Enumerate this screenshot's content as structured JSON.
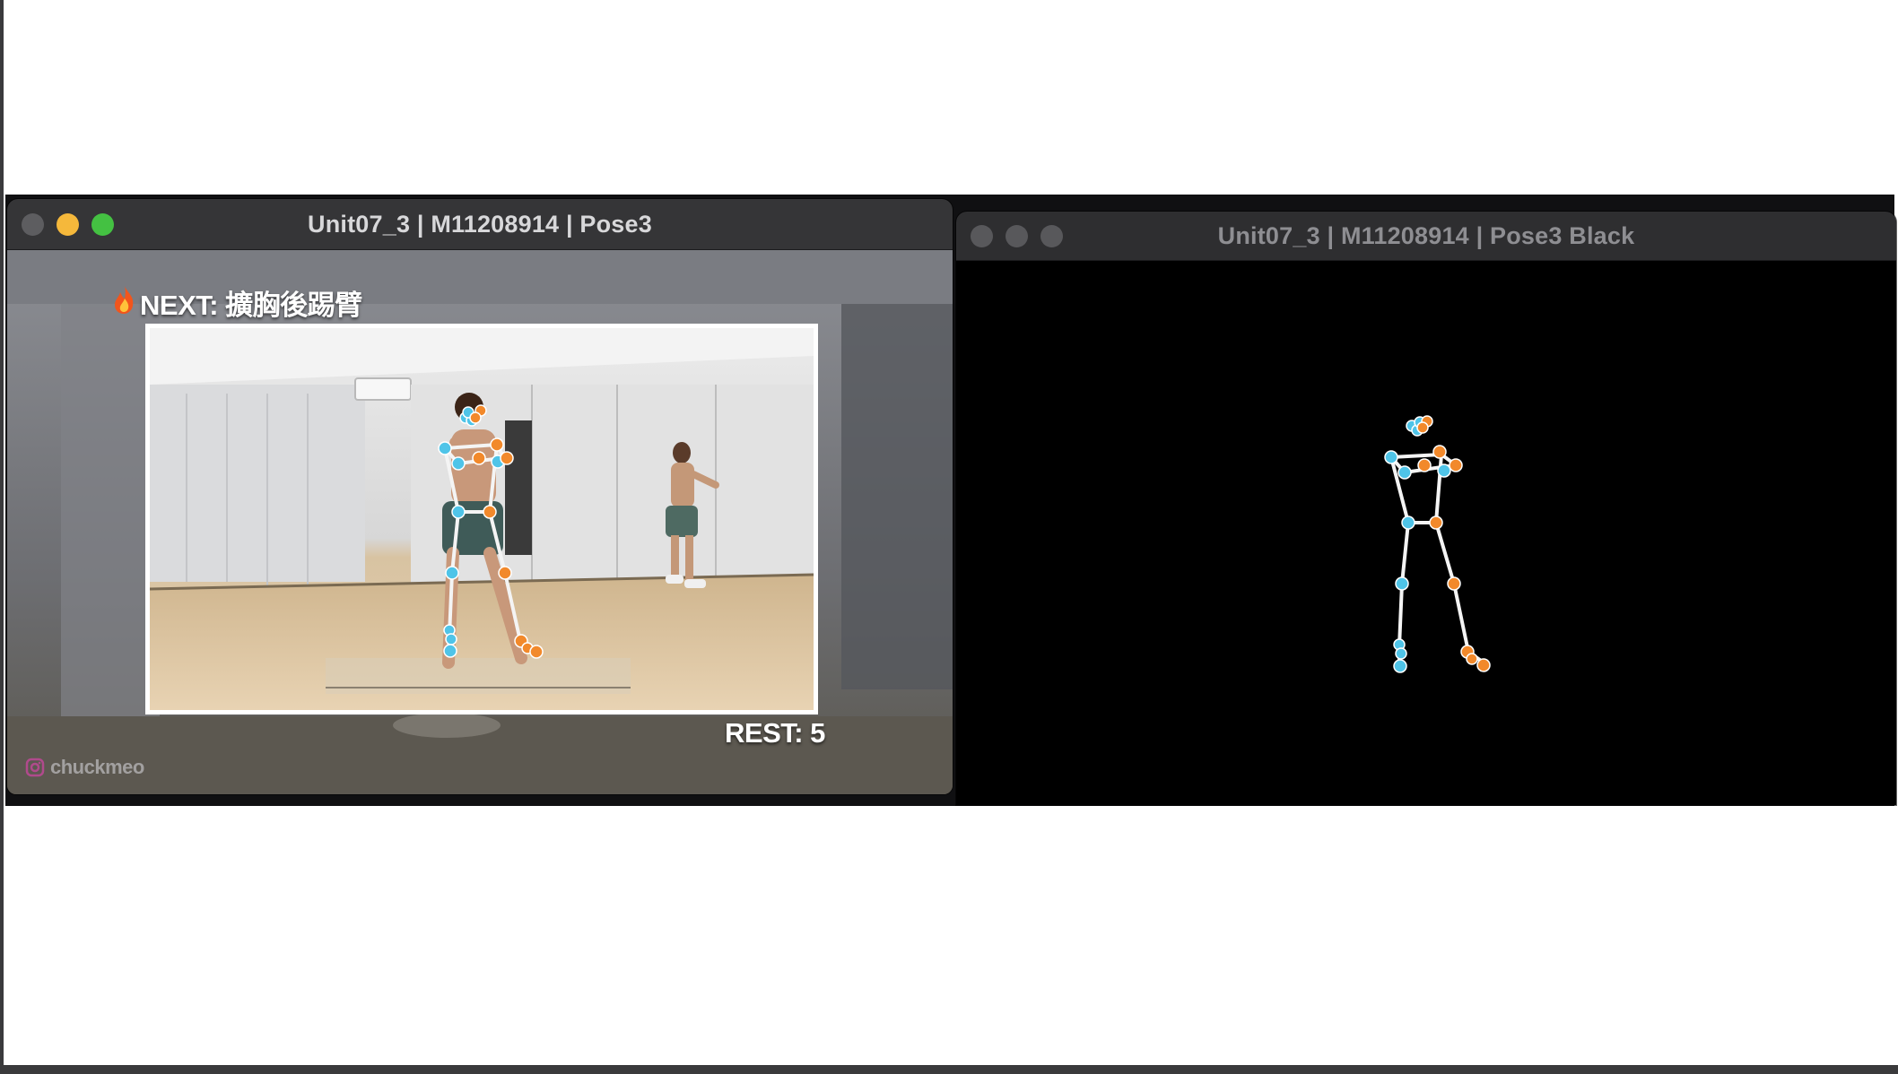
{
  "windows": [
    {
      "title": "Unit07_3 | M11208914 | Pose3",
      "overlay": {
        "next_label": "NEXT: 擴胸後踢臂",
        "rest_label": "REST: 5",
        "handle": "chuckmeo"
      },
      "icons": [
        "fire-icon",
        "instagram-icon"
      ]
    },
    {
      "title": "Unit07_3 | M11208914 | Pose3 Black"
    }
  ],
  "colors": {
    "left_joint": "#4fc4e8",
    "right_joint": "#f2892b",
    "bone": "#f4f4f4",
    "window_titlebar": "#353537",
    "traffic_min": "#f5b83b",
    "traffic_zoom": "#44c142"
  }
}
